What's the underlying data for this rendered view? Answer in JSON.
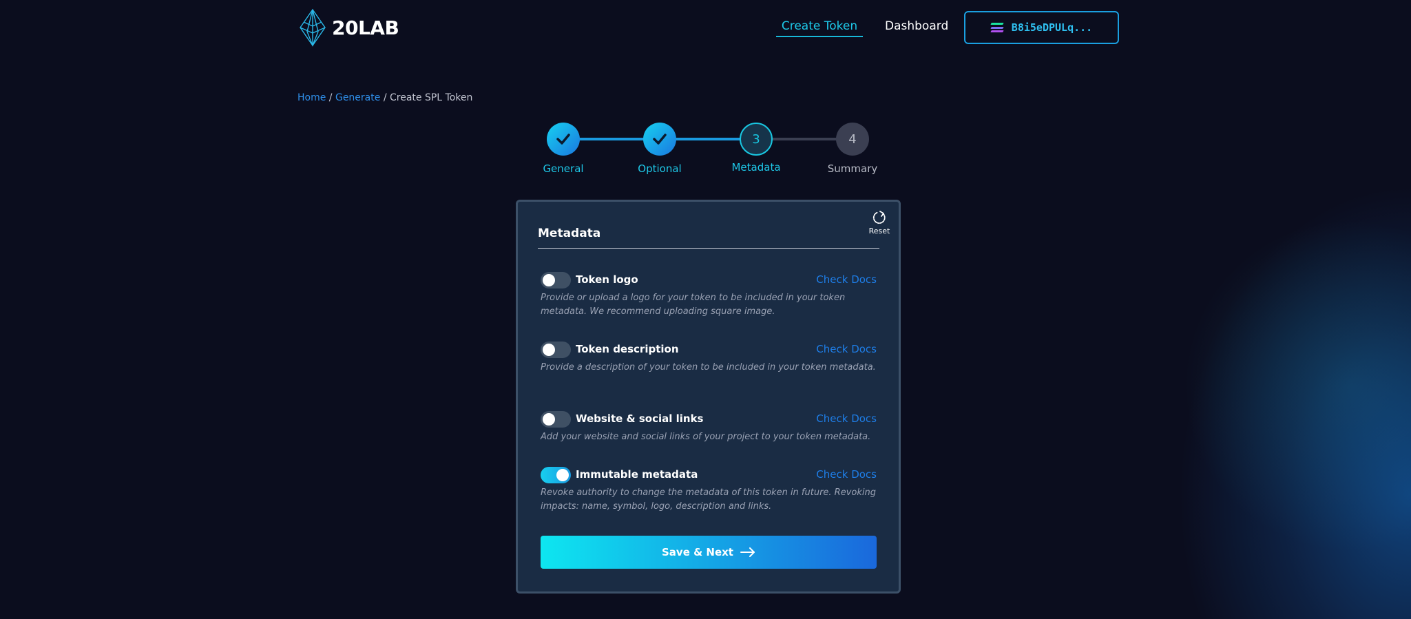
{
  "header": {
    "logo_text": "20LAB",
    "nav": {
      "create_token": "Create Token",
      "dashboard": "Dashboard"
    },
    "wallet_address": "B8i5eDPULq..."
  },
  "breadcrumb": {
    "home": "Home",
    "generate": "Generate",
    "current": "Create SPL Token",
    "separator": "/"
  },
  "stepper": {
    "steps": [
      {
        "label": "General",
        "number": "1",
        "status": "done"
      },
      {
        "label": "Optional",
        "number": "2",
        "status": "done"
      },
      {
        "label": "Metadata",
        "number": "3",
        "status": "current"
      },
      {
        "label": "Summary",
        "number": "4",
        "status": "todo"
      }
    ]
  },
  "card": {
    "title": "Metadata",
    "reset_label": "Reset",
    "options": [
      {
        "label": "Token logo",
        "docs": "Check Docs",
        "enabled": false,
        "description": "Provide or upload a logo for your token to be included in your token metadata. We recommend uploading square image."
      },
      {
        "label": "Token description",
        "docs": "Check Docs",
        "enabled": false,
        "description": "Provide a description of your token to be included in your token metadata."
      },
      {
        "label": "Website & social links",
        "docs": "Check Docs",
        "enabled": false,
        "description": "Add your website and social links of your project to your token metadata."
      },
      {
        "label": "Immutable metadata",
        "docs": "Check Docs",
        "enabled": true,
        "description": "Revoke authority to change the metadata of this token in future. Revoking impacts: name, symbol, logo, description and links."
      }
    ],
    "save_label": "Save & Next"
  },
  "colors": {
    "accent": "#19c6e0",
    "link": "#1e7ee8",
    "background": "#0b0d1e",
    "card": "#1a2c44"
  }
}
